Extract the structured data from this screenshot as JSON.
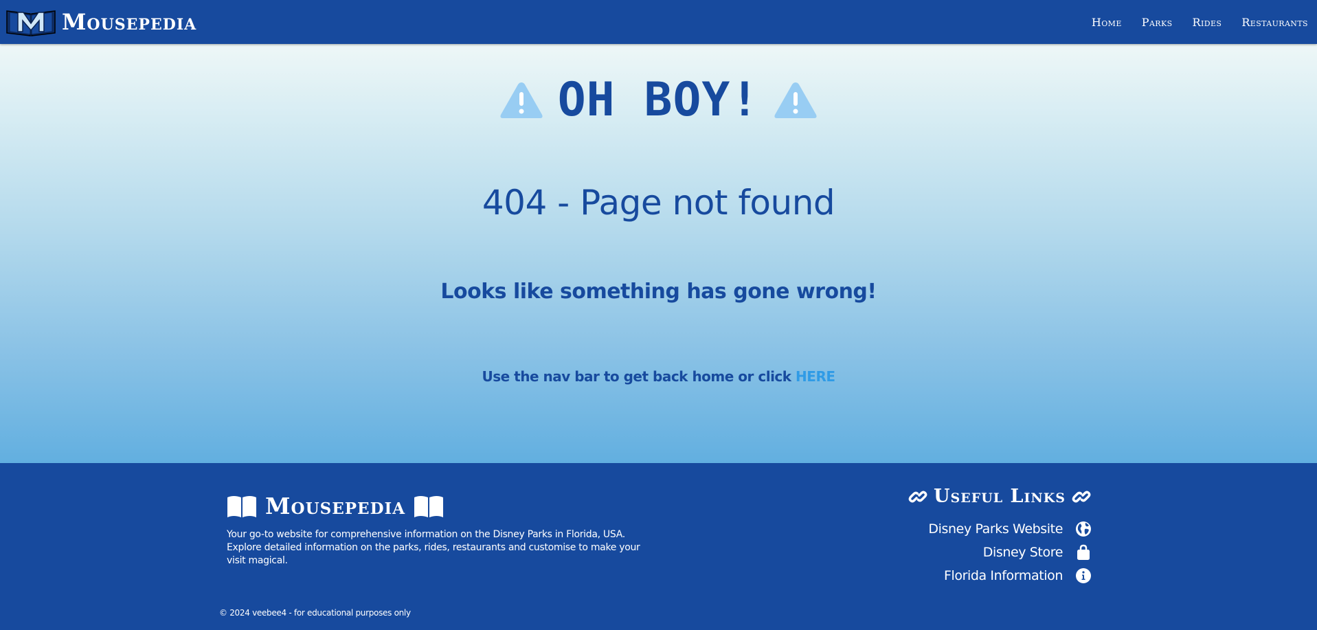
{
  "nav": {
    "brand": "Mousepedia",
    "links": [
      "Home",
      "Parks",
      "Rides",
      "Restaurants"
    ]
  },
  "main": {
    "headline": "OH BOY!",
    "error_code": "404 - Page not found",
    "message": "Looks like something has gone wrong!",
    "hint": "Use the nav bar to get back home or click ",
    "link": "HERE"
  },
  "footer": {
    "brand": "Mousepedia",
    "description": "Your go-to website for comprehensive information on the Disney Parks in Florida, USA. Explore detailed information on the parks, rides, restaurants and customise to make your visit magical.",
    "copyright": "© 2024 veebee4 - for educational purposes only",
    "links_title": "Useful Links",
    "links": [
      {
        "label": "Disney Parks Website",
        "icon": "globe-icon"
      },
      {
        "label": "Disney Store",
        "icon": "shopping-bag-icon"
      },
      {
        "label": "Florida Information",
        "icon": "info-icon"
      }
    ]
  },
  "colors": {
    "primary": "#174a9e",
    "accent_link": "#2f9be6",
    "warning_icon": "#98cdf3",
    "gradient_top": "#eef7f7",
    "gradient_bottom": "#62afe0"
  }
}
